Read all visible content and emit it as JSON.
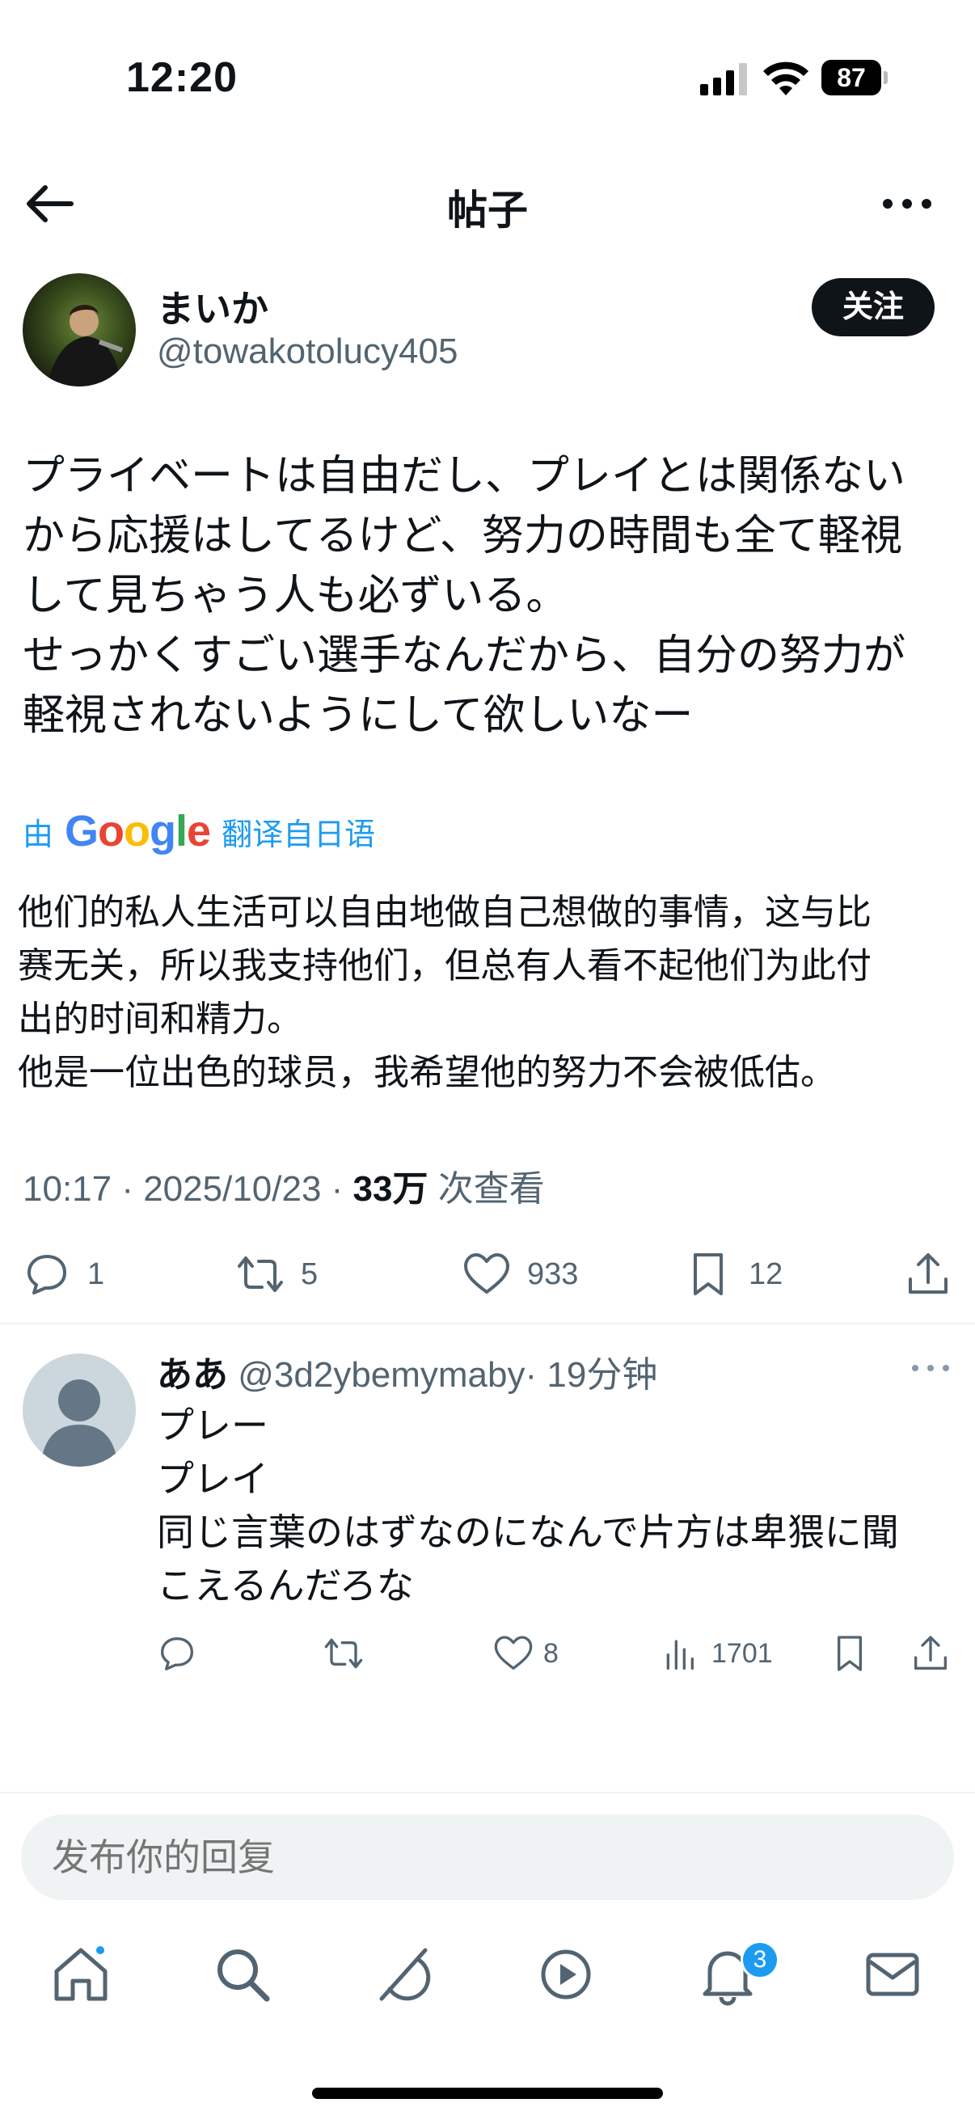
{
  "status_bar": {
    "time": "12:20",
    "battery": "87"
  },
  "header": {
    "title": "帖子"
  },
  "post": {
    "author_name": "まいか",
    "author_handle": "@towakotolucy405",
    "follow_label": "关注",
    "text": "プライベートは自由だし、プレイとは関係ない\nから応援はしてるけど、努力の時間も全て軽視\nして見ちゃう人も必ずいる。\nせっかくすごい選手なんだから、自分の努力が\n軽視されないようにして欲しいなー",
    "translate_prefix": "由",
    "translate_provider": "Google",
    "translate_suffix": "翻译自日语",
    "translated_text": "他们的私人生活可以自由地做自己想做的事情，这与比\n赛无关，所以我支持他们，但总有人看不起他们为此付\n出的时间和精力。\n他是一位出色的球员，我希望他的努力不会被低估。",
    "timestamp": "10:17 · 2025/10/23 · ",
    "views_count": "33万",
    "views_label": " 次查看",
    "replies": "1",
    "reposts": "5",
    "likes": "933",
    "bookmarks": "12"
  },
  "reply": {
    "author_name": "ああ",
    "author_handle": "@3d2ybemymaby",
    "time": "· 19分钟",
    "text": "プレー\nプレイ\n同じ言葉のはずなのになんで片方は卑猥に聞\nこえるんだろな",
    "likes": "8",
    "views": "1701"
  },
  "composer": {
    "placeholder": "发布你的回复"
  },
  "tabs": {
    "notifications_badge": "3"
  }
}
